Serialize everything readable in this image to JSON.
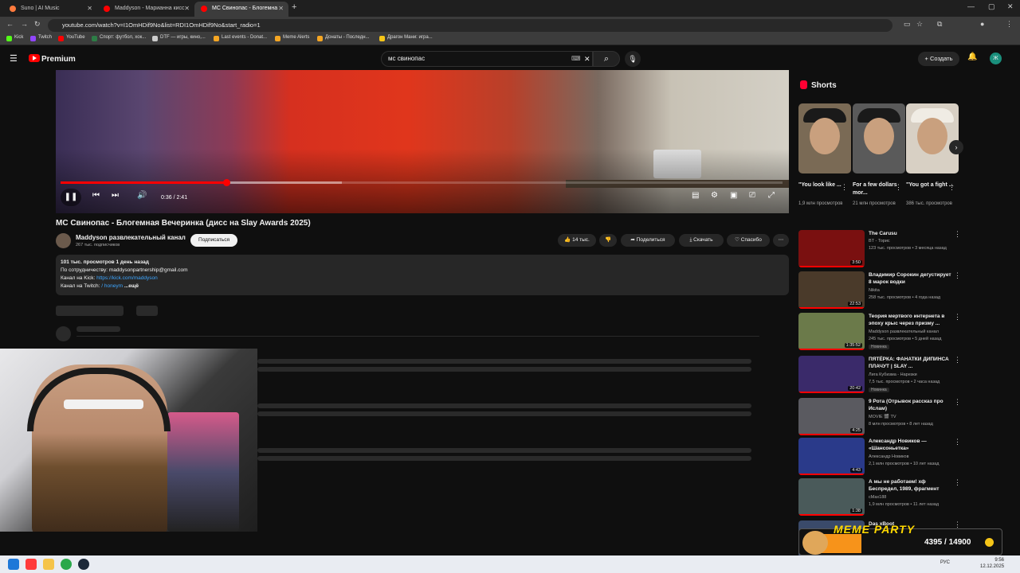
{
  "browser": {
    "tabs": [
      {
        "title": "Suno | AI Music",
        "color": "#ff7a3d",
        "active": false
      },
      {
        "title": "Maddyson - Марианна кисс -",
        "color": "#ff0000",
        "active": false
      },
      {
        "title": "МС Свинопас - Блогемна",
        "color": "#ff0000",
        "active": true
      }
    ],
    "new_tab_label": "+",
    "url": "youtube.com/watch?v=I1OmHDif9No&list=RDI1OmHDif9No&start_radio=1",
    "bookmarks": [
      {
        "label": "Kick",
        "color": "#53fc18"
      },
      {
        "label": "Twitch",
        "color": "#9146ff"
      },
      {
        "label": "YouTube",
        "color": "#ff0000"
      },
      {
        "label": "Спорт: футбол, хок...",
        "color": "#2d7d46"
      },
      {
        "label": "DTF — игры, кино,...",
        "color": "#cccccc"
      },
      {
        "label": "Last events - Donat...",
        "color": "#f5a623"
      },
      {
        "label": "Meme Alerts",
        "color": "#f5a623"
      },
      {
        "label": "Донаты - Последн...",
        "color": "#f5a623"
      },
      {
        "label": "Драгон Мани: игра...",
        "color": "#f5c518"
      }
    ]
  },
  "youtube": {
    "logo": "Premium",
    "search_value": "мс свинопас",
    "create_label": "Создать",
    "avatar_letter": "Ж"
  },
  "player": {
    "time": "0:36 / 2:41",
    "played_fraction": 0.23,
    "buffered_fraction": 0.39
  },
  "video": {
    "title": "MC Свинопас - Блогемная Вечеринка (дисс на Slay Awards 2025)",
    "channel": "Maddyson развлекательный канал",
    "subscribers": "267 тыс. подписчиков",
    "subscribe_label": "Подписаться",
    "likes": "14 тыс.",
    "share_label": "Поделиться",
    "download_label": "Скачать",
    "thanks_label": "Спасибо",
    "desc_stats": "101 тыс. просмотров  1 день назад",
    "desc_line1": "По сотрудничеству: maddysonpartnership@gmail.com",
    "desc_line2_prefix": "Канал на Kick: ",
    "desc_line2_link": "https://kick.com/maddyson",
    "desc_line3_prefix": "Канал на Twitch: ",
    "desc_line3_link": "/ honeym",
    "desc_more": "...ещё"
  },
  "shorts": {
    "heading": "Shorts",
    "items": [
      {
        "title": "\"You look like ...",
        "views": "1,9 млн просмотров"
      },
      {
        "title": "For a few dollars mor...",
        "views": "21 млн просмотров"
      },
      {
        "title": "\"You got a fight ...",
        "views": "386 тыс. просмотров"
      }
    ]
  },
  "recommendations": [
    {
      "title": "The Carusu",
      "channel": "BT - Торис",
      "meta": "123 тыс. просмотров • 3 месяца назад",
      "duration": "3:50",
      "badge": "",
      "thumb": "#7a1010"
    },
    {
      "title": "Владимир Сорокин дегустирует 8 марок водки",
      "channel": "Nikita",
      "meta": "258 тыс. просмотров • 4 года назад",
      "duration": "22:53",
      "badge": "",
      "thumb": "#4a3a2a"
    },
    {
      "title": "Теория мертвого интернета в эпоху крыс через призму ...",
      "channel": "Maddyson развлекательный канал",
      "meta": "245 тыс. просмотров • 5 дней назад",
      "duration": "1:35:52",
      "badge": "Новинка",
      "thumb": "#6b7a4a"
    },
    {
      "title": "ПЯТЁРКА: ФАНАТКИ ДИПИНСА ПЛАЧУТ | SLAY ...",
      "channel": "Лига Кубизма - Нарезки",
      "meta": "7,5 тыс. просмотров • 2 часа назад",
      "duration": "20:42",
      "badge": "Новинка",
      "thumb": "#3a2a6a"
    },
    {
      "title": "9 Рота (Отрывок рассказ про Ислам)",
      "channel": "MOVIE 🎬 TV",
      "meta": "8 млн просмотров • 8 лет назад",
      "duration": "4:25",
      "badge": "",
      "thumb": "#5a5a60"
    },
    {
      "title": "Александр Новиков — «Шансоньетка»",
      "channel": "Александр Новиков",
      "meta": "2,1 млн просмотров • 10 лет назад",
      "duration": "4:43",
      "badge": "",
      "thumb": "#2a3a8a"
    },
    {
      "title": "А мы не работаем! хф Беспредел, 1989, фрагмент",
      "channel": "cMax188",
      "meta": "1,9 млн просмотров • 11 лет назад",
      "duration": "1:38",
      "badge": "",
      "thumb": "#4a5a5a"
    },
    {
      "title": "Das xBoot",
      "channel": "",
      "meta": "",
      "duration": "",
      "badge": "",
      "thumb": "#3a4a6a"
    }
  ],
  "overlay": {
    "title": "MEME PARTY",
    "count": "4395 / 14900"
  },
  "taskbar": {
    "lang": "РУС",
    "time": "9:56",
    "date": "12.12.2025"
  }
}
